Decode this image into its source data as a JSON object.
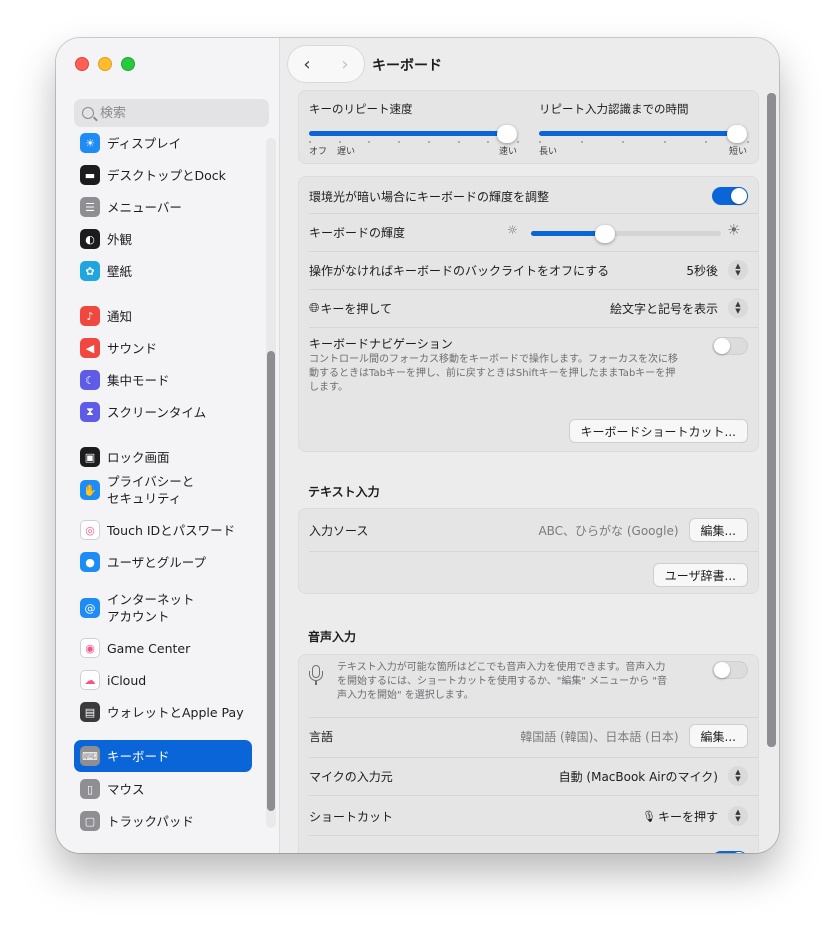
{
  "window": {
    "title": "キーボード"
  },
  "search": {
    "placeholder": "検索"
  },
  "sidebar": {
    "items": [
      {
        "label": "ディスプレイ",
        "icon": "sun-icon",
        "color": "#1e8cf5"
      },
      {
        "label": "デスクトップとDock",
        "icon": "dock-icon",
        "color": "#1c1c1e"
      },
      {
        "label": "メニューバー",
        "icon": "menubar-icon",
        "color": "#8e8e93"
      },
      {
        "label": "外観",
        "icon": "appearance-icon",
        "color": "#1c1c1e"
      },
      {
        "label": "壁紙",
        "icon": "wallpaper-icon",
        "color": "#1fa6e0"
      },
      {
        "label": "通知",
        "icon": "bell-icon",
        "color": "#f0483e"
      },
      {
        "label": "サウンド",
        "icon": "speaker-icon",
        "color": "#f0483e"
      },
      {
        "label": "集中モード",
        "icon": "moon-icon",
        "color": "#5e5ce6"
      },
      {
        "label": "スクリーンタイム",
        "icon": "hourglass-icon",
        "color": "#5e5ce6"
      },
      {
        "label": "ロック画面",
        "icon": "lock-icon",
        "color": "#1c1c1e"
      },
      {
        "label": "プライバシーと\nセキュリティ",
        "icon": "hand-icon",
        "color": "#1e8cf5"
      },
      {
        "label": "Touch IDとパスワード",
        "icon": "fingerprint-icon",
        "color": "#ffffff"
      },
      {
        "label": "ユーザとグループ",
        "icon": "users-icon",
        "color": "#1e8cf5"
      },
      {
        "label": "インターネット\nアカウント",
        "icon": "at-icon",
        "color": "#1e8cf5"
      },
      {
        "label": "Game Center",
        "icon": "gamecenter-icon",
        "color": "#ffffff"
      },
      {
        "label": "iCloud",
        "icon": "cloud-icon",
        "color": "#ffffff"
      },
      {
        "label": "ウォレットとApple Pay",
        "icon": "wallet-icon",
        "color": "#3a3a3c"
      },
      {
        "label": "キーボード",
        "icon": "keyboard-icon",
        "color": "#8e8e93"
      },
      {
        "label": "マウス",
        "icon": "mouse-icon",
        "color": "#8e8e93"
      },
      {
        "label": "トラックパッド",
        "icon": "trackpad-icon",
        "color": "#8e8e93"
      }
    ]
  },
  "repeat": {
    "key_repeat_label": "キーのリピート速度",
    "delay_label": "リピート入力認識までの時間",
    "key_repeat_min": "オフ",
    "key_repeat_slow": "遅い",
    "key_repeat_max": "速い",
    "delay_min": "長い",
    "delay_max": "短い",
    "key_repeat_level": 1.0,
    "delay_level": 1.0
  },
  "backlight": {
    "auto_brightness_label": "環境光が暗い場合にキーボードの輝度を調整",
    "brightness_label": "キーボードの輝度",
    "brightness_level": 0.39,
    "off_after_label": "操作がなければキーボードのバックライトをオフにする",
    "off_after_value": "5秒後",
    "globe_key_label": "キーを押して",
    "globe_key_value": "絵文字と記号を表示",
    "nav_label": "キーボードナビゲーション",
    "nav_desc": "コントロール間のフォーカス移動をキーボードで操作します。フォーカスを次に移動するときはTabキーを押し、前に戻すときはShiftキーを押したままTabキーを押します。",
    "shortcuts_button": "キーボードショートカット..."
  },
  "text_input": {
    "title": "テキスト入力",
    "sources_label": "入力ソース",
    "sources_value": "ABC、ひらがな (Google)",
    "edit_button": "編集...",
    "dictionary_button": "ユーザ辞書..."
  },
  "dictation": {
    "title": "音声入力",
    "desc": "テキスト入力が可能な箇所はどこでも音声入力を使用できます。音声入力を開始するには、ショートカットを使用するか、\"編集\" メニューから \"音声入力を開始\" を選択します。",
    "language_label": "言語",
    "language_value": "韓国語 (韓国)、日本語 (日本)",
    "edit_button": "編集...",
    "mic_label": "マイクの入力元",
    "mic_value": "自動 (MacBook Airのマイク)",
    "shortcut_label": "ショートカット",
    "shortcut_value": "キーを押す"
  }
}
